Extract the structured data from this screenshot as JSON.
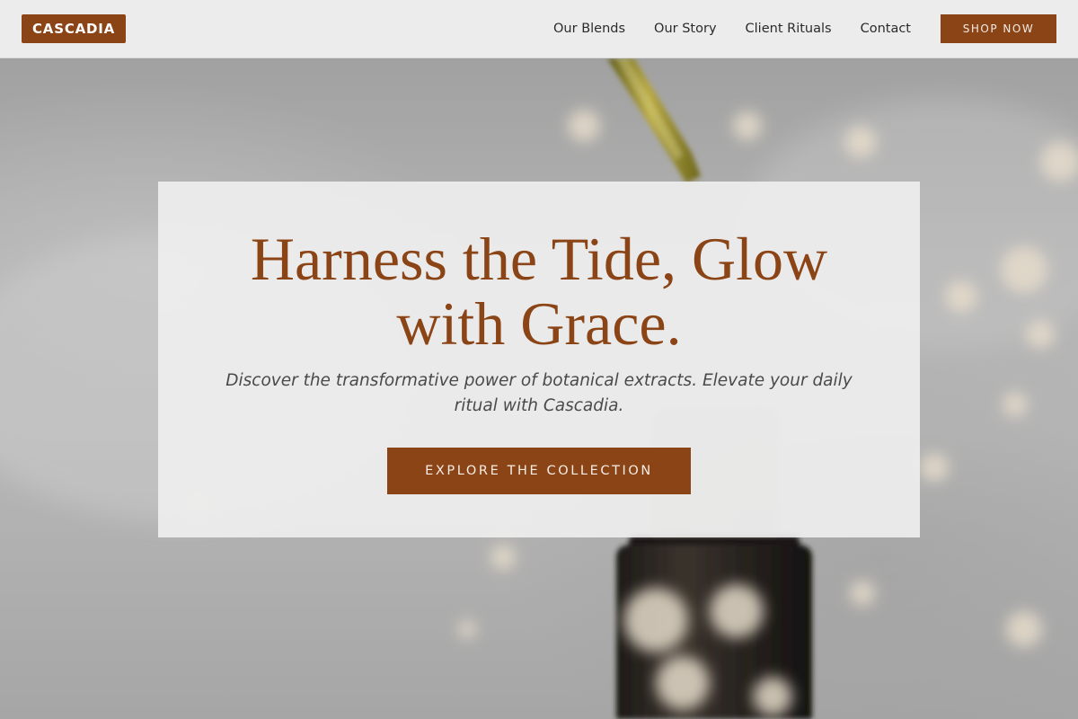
{
  "header": {
    "logo": "CASCADIA",
    "nav": [
      {
        "label": "Our Blends"
      },
      {
        "label": "Our Story"
      },
      {
        "label": "Client Rituals"
      },
      {
        "label": "Contact"
      }
    ],
    "cta_label": "SHOP NOW"
  },
  "hero": {
    "title": "Harness the Tide, Glow with Grace.",
    "subtitle": "Discover the transformative power of botanical extracts. Elevate your daily ritual with Cascadia.",
    "cta_label": "EXPLORE THE COLLECTION",
    "background_image": "serum-dropper-bottle-with-flowers"
  },
  "colors": {
    "brand": "#8b4416",
    "header_bg": "#ececec",
    "card_bg": "#f0f0f0",
    "text_muted": "#4a4a4a"
  }
}
